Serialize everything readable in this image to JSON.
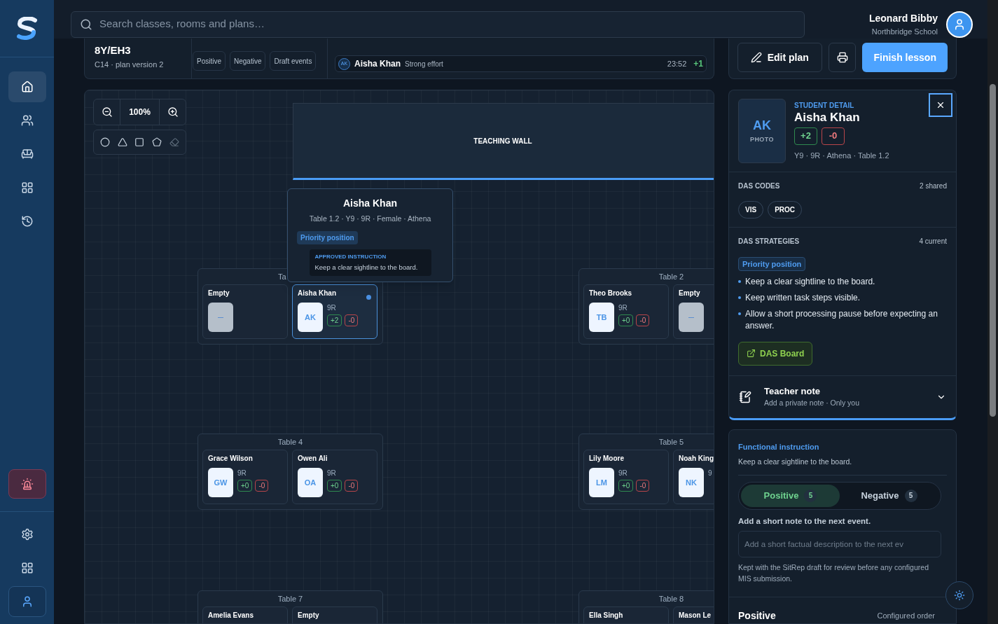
{
  "sidebar": {
    "nav": [
      {
        "kind": "home",
        "selected": true
      },
      {
        "kind": "people",
        "selected": false
      },
      {
        "kind": "seat",
        "selected": false
      },
      {
        "kind": "grid",
        "selected": false
      },
      {
        "kind": "history",
        "selected": false
      }
    ],
    "alert": {
      "kind": "siren"
    },
    "bottom": [
      {
        "kind": "settings",
        "selected": false
      },
      {
        "kind": "grid",
        "selected": false
      },
      {
        "kind": "user",
        "selected": true
      }
    ]
  },
  "header": {
    "search": {
      "placeholder": "Search classes, rooms and plans…"
    },
    "user": {
      "name": "Leonard Bibby",
      "school": "Northbridge School"
    }
  },
  "lesson": {
    "class": "8Y/EH3",
    "plan": "C14 · plan version 2",
    "filters": [
      "Positive",
      "Negative",
      "Draft events"
    ],
    "events": [
      {
        "initials": "AK",
        "name": "Aisha Khan",
        "note": "Strong effort",
        "time": "23:52",
        "score": "+1"
      }
    ]
  },
  "actions": {
    "edit": "Edit plan",
    "finish": "Finish lesson"
  },
  "canvas": {
    "zoom": "100%",
    "wall": "TEACHING WALL",
    "tables": [
      {
        "label": "Ta",
        "seats": [
          {
            "kind": "empty",
            "name": "Empty",
            "selected": false
          },
          {
            "kind": "student",
            "name": "Aisha Khan",
            "initials": "AK",
            "form": "9R",
            "pos": "+2",
            "neg": "-0",
            "selected": true,
            "dot": true
          }
        ]
      },
      {
        "label": "Table 2",
        "seats": [
          {
            "kind": "student",
            "name": "Theo Brooks",
            "initials": "TB",
            "form": "9R",
            "pos": "+0",
            "neg": "-0",
            "selected": false,
            "dot": false
          },
          {
            "kind": "empty",
            "name": "Empty",
            "selected": false
          }
        ]
      },
      {
        "label": "Table 4",
        "seats": [
          {
            "kind": "student",
            "name": "Grace Wilson",
            "initials": "GW",
            "form": "9R",
            "pos": "+0",
            "neg": "-0",
            "selected": false,
            "dot": false
          },
          {
            "kind": "student",
            "name": "Owen Ali",
            "initials": "OA",
            "form": "9R",
            "pos": "+0",
            "neg": "-0",
            "selected": false,
            "dot": false
          }
        ]
      },
      {
        "label": "Table 5",
        "seats": [
          {
            "kind": "student",
            "name": "Lily Moore",
            "initials": "LM",
            "form": "9R",
            "pos": "+0",
            "neg": "-0",
            "selected": false,
            "dot": false
          },
          {
            "kind": "student",
            "name": "Noah King",
            "initials": "NK",
            "form": "9",
            "selected": false,
            "dot": false
          }
        ]
      },
      {
        "label": "Table 7",
        "seats": [
          {
            "kind": "partial",
            "name": "Amelia Evans",
            "selected": false
          },
          {
            "kind": "partial",
            "name": "Empty",
            "selected": false
          }
        ]
      },
      {
        "label": "Table 8",
        "seats": [
          {
            "kind": "partial",
            "name": "Ella Singh",
            "selected": false
          },
          {
            "kind": "partial",
            "name": "Mason Le",
            "selected": false
          }
        ]
      }
    ],
    "popover": {
      "name": "Aisha Khan",
      "meta": "Table 1.2 · Y9 · 9R · Female · Athena",
      "tag": "Priority position",
      "instruction_title": "APPROVED INSTRUCTION",
      "instruction": "Keep a clear sightline to the board."
    }
  },
  "detail": {
    "label": "STUDENT DETAIL",
    "name": "Aisha Khan",
    "initials": "AK",
    "photo": "PHOTO",
    "pos": "+2",
    "neg": "-0",
    "meta": "Y9 · 9R · Athena · Table 1.2",
    "codes": {
      "title": "DAS CODES",
      "count": "2 shared",
      "items": [
        "VIS",
        "PROC"
      ]
    },
    "strategies": {
      "title": "DAS STRATEGIES",
      "count": "4 current",
      "tag": "Priority position",
      "items": [
        "Keep a clear sightline to the board.",
        "Keep written task steps visible.",
        "Allow a short processing pause before expecting an answer."
      ]
    },
    "board": "DAS Board",
    "note": {
      "title": "Teacher note",
      "subtitle": "Add a private note · Only you",
      "expanded": false
    }
  },
  "events_panel": {
    "title": "Functional instruction",
    "text": "Keep a clear sightline to the board.",
    "toggle": [
      {
        "label": "Positive",
        "count": "5",
        "selected": true
      },
      {
        "label": "Negative",
        "count": "5",
        "selected": false
      }
    ],
    "note_label": "Add a short note to the next event.",
    "note_placeholder": "Add a short factual description to the next ev",
    "help": "Kept with the SitRep draft for review before any configured MIS submission.",
    "list_title": "Positive",
    "list_order": "Configured order"
  }
}
